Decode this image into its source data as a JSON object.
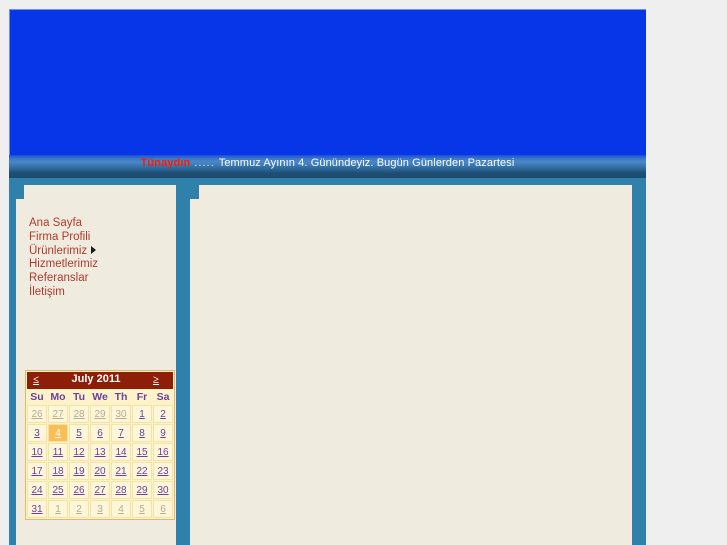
{
  "site": {
    "hero_banner_color": "#0636e8",
    "body_color": "#2f81ab",
    "panel_color": "#efecdf"
  },
  "greeting": {
    "name": "Tünaydın",
    "dots": " ..... ",
    "message": "Temmuz Ayının 4. Günündeyiz. Bugün Günlerden Pazartesi"
  },
  "nav": {
    "items": [
      {
        "label": "Ana Sayfa",
        "has_submenu": false
      },
      {
        "label": "Firma Profili",
        "has_submenu": false
      },
      {
        "label": "Ürünlerimiz",
        "has_submenu": true
      },
      {
        "label": "Hizmetlerimiz",
        "has_submenu": false
      },
      {
        "label": "Referanslar",
        "has_submenu": false
      },
      {
        "label": "İletişim",
        "has_submenu": false
      }
    ]
  },
  "calendar": {
    "title": "July 2011",
    "prev_label": "≤",
    "next_label": "≥",
    "daynames": [
      "Su",
      "Mo",
      "Tu",
      "We",
      "Th",
      "Fr",
      "Sa"
    ],
    "weeks": [
      [
        {
          "d": "26",
          "other": true,
          "selected": false
        },
        {
          "d": "27",
          "other": true,
          "selected": false
        },
        {
          "d": "28",
          "other": true,
          "selected": false
        },
        {
          "d": "29",
          "other": true,
          "selected": false
        },
        {
          "d": "30",
          "other": true,
          "selected": false
        },
        {
          "d": "1",
          "other": false,
          "selected": false
        },
        {
          "d": "2",
          "other": false,
          "selected": false
        }
      ],
      [
        {
          "d": "3",
          "other": false,
          "selected": false
        },
        {
          "d": "4",
          "other": false,
          "selected": true
        },
        {
          "d": "5",
          "other": false,
          "selected": false
        },
        {
          "d": "6",
          "other": false,
          "selected": false
        },
        {
          "d": "7",
          "other": false,
          "selected": false
        },
        {
          "d": "8",
          "other": false,
          "selected": false
        },
        {
          "d": "9",
          "other": false,
          "selected": false
        }
      ],
      [
        {
          "d": "10",
          "other": false,
          "selected": false
        },
        {
          "d": "11",
          "other": false,
          "selected": false
        },
        {
          "d": "12",
          "other": false,
          "selected": false
        },
        {
          "d": "13",
          "other": false,
          "selected": false
        },
        {
          "d": "14",
          "other": false,
          "selected": false
        },
        {
          "d": "15",
          "other": false,
          "selected": false
        },
        {
          "d": "16",
          "other": false,
          "selected": false
        }
      ],
      [
        {
          "d": "17",
          "other": false,
          "selected": false
        },
        {
          "d": "18",
          "other": false,
          "selected": false
        },
        {
          "d": "19",
          "other": false,
          "selected": false
        },
        {
          "d": "20",
          "other": false,
          "selected": false
        },
        {
          "d": "21",
          "other": false,
          "selected": false
        },
        {
          "d": "22",
          "other": false,
          "selected": false
        },
        {
          "d": "23",
          "other": false,
          "selected": false
        }
      ],
      [
        {
          "d": "24",
          "other": false,
          "selected": false
        },
        {
          "d": "25",
          "other": false,
          "selected": false
        },
        {
          "d": "26",
          "other": false,
          "selected": false
        },
        {
          "d": "27",
          "other": false,
          "selected": false
        },
        {
          "d": "28",
          "other": false,
          "selected": false
        },
        {
          "d": "29",
          "other": false,
          "selected": false
        },
        {
          "d": "30",
          "other": false,
          "selected": false
        }
      ],
      [
        {
          "d": "31",
          "other": false,
          "selected": false
        },
        {
          "d": "1",
          "other": true,
          "selected": false
        },
        {
          "d": "2",
          "other": true,
          "selected": false
        },
        {
          "d": "3",
          "other": true,
          "selected": false
        },
        {
          "d": "4",
          "other": true,
          "selected": false
        },
        {
          "d": "5",
          "other": true,
          "selected": false
        },
        {
          "d": "6",
          "other": true,
          "selected": false
        }
      ]
    ]
  }
}
